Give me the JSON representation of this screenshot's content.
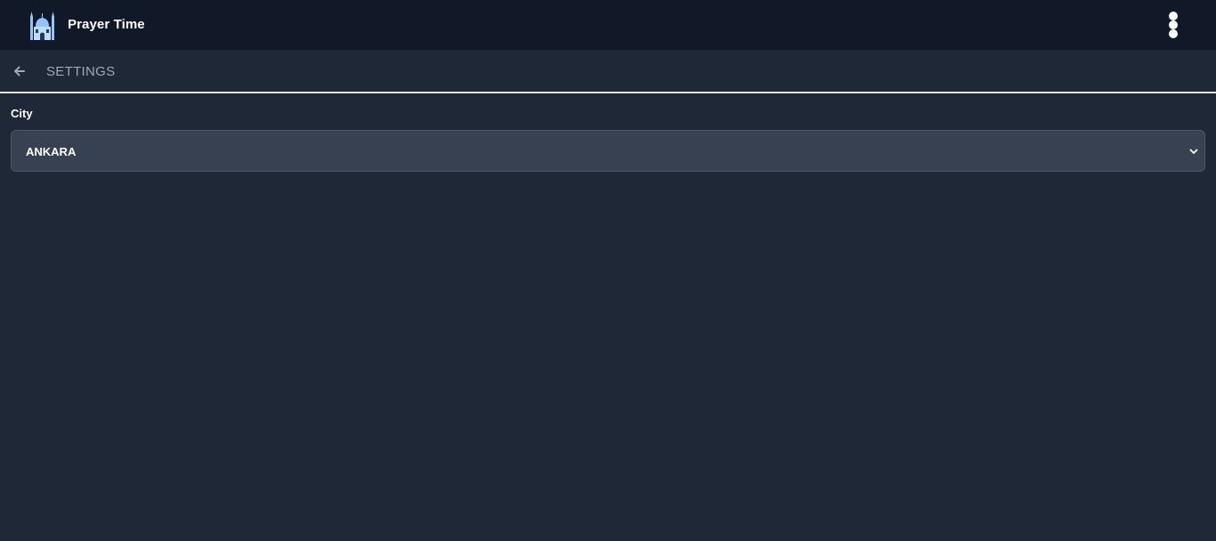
{
  "header": {
    "app_title": "Prayer Time",
    "logo_icon": "mosque-icon",
    "menu_icon": "kebab-menu-icon"
  },
  "subheader": {
    "back_icon": "arrow-left-icon",
    "title": "SETTINGS"
  },
  "settings": {
    "city": {
      "label": "City",
      "selected": "ANKARA"
    }
  },
  "colors": {
    "topbar_bg": "#111827",
    "page_bg": "#1f2837",
    "select_bg": "#374151",
    "heading_text": "#a0a8b6",
    "logo_accent": "#93c5fd"
  }
}
